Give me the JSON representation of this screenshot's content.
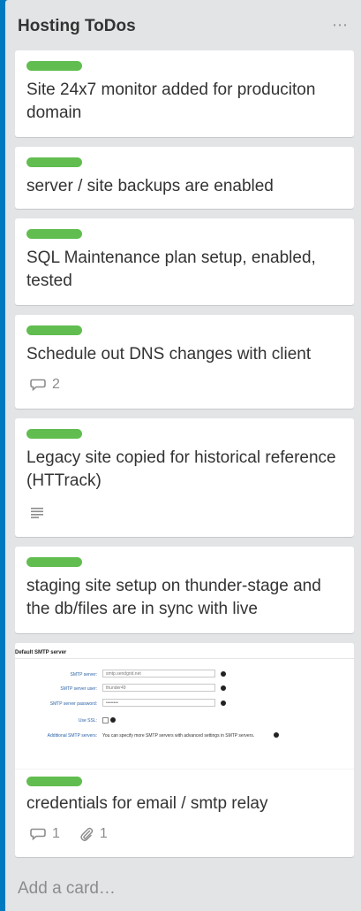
{
  "list": {
    "title": "Hosting ToDos",
    "menu_label": "⋯",
    "add_card_label": "Add a card…"
  },
  "colors": {
    "board": "#0079bf",
    "list": "#e2e4e6",
    "label_green": "#61bd4f"
  },
  "cards": [
    {
      "title": "Site 24x7 monitor added for produciton domain",
      "label": "green"
    },
    {
      "title": "server / site backups are enabled",
      "label": "green"
    },
    {
      "title": "SQL Maintenance plan setup, enabled, tested",
      "label": "green"
    },
    {
      "title": "Schedule out DNS changes with client",
      "label": "green",
      "comments": "2"
    },
    {
      "title": "Legacy site copied for historical reference (HTTrack)",
      "label": "green",
      "has_description": true
    },
    {
      "title": "staging site setup on thunder-stage and the db/files are in sync with live",
      "label": "green"
    },
    {
      "title": "credentials for email / smtp relay",
      "label": "green",
      "comments": "1",
      "attachments": "1",
      "cover": {
        "heading": "Default SMTP server",
        "fields": [
          {
            "label": "SMTP server:",
            "value": "smtp.sendgrid.net"
          },
          {
            "label": "SMTP server user:",
            "value": "thunder49"
          },
          {
            "label": "SMTP server password:",
            "value": "••••••••"
          }
        ],
        "ssl_label": "Use SSL:",
        "additional_label": "Additional SMTP servers:",
        "additional_note": "You can specify more SMTP servers with advanced settings in SMTP servers."
      }
    }
  ]
}
